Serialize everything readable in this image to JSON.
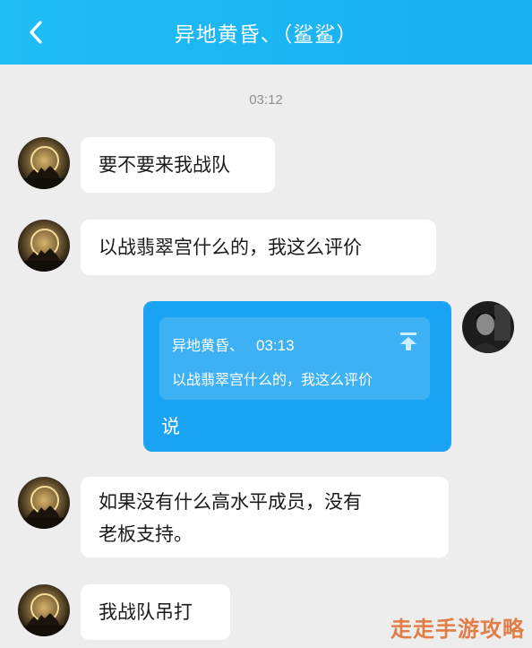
{
  "header": {
    "title": "异地黄昏、（鲨鲨）",
    "back_icon": "chevron-left-icon",
    "background": "#1fbdf6"
  },
  "timestamp": "03:12",
  "messages": [
    {
      "direction": "incoming",
      "text": "要不要来我战队"
    },
    {
      "direction": "incoming",
      "text": "以战翡翠宫什么的，我这么评价"
    },
    {
      "direction": "outgoing",
      "quote": {
        "author": "异地黄昏、",
        "time": "03:13",
        "text": "以战翡翠宫什么的，我这么评价"
      },
      "text": "说"
    },
    {
      "direction": "incoming",
      "text_line1": "如果没有什么高水平成员，没有",
      "text_line2": "老板支持。"
    },
    {
      "direction": "incoming",
      "text": "我战队吊打"
    }
  ],
  "watermark": "走走手游攻略",
  "colors": {
    "outgoing_bubble": "#1aa3f3",
    "incoming_bubble": "#ffffff",
    "background": "#ededed"
  }
}
